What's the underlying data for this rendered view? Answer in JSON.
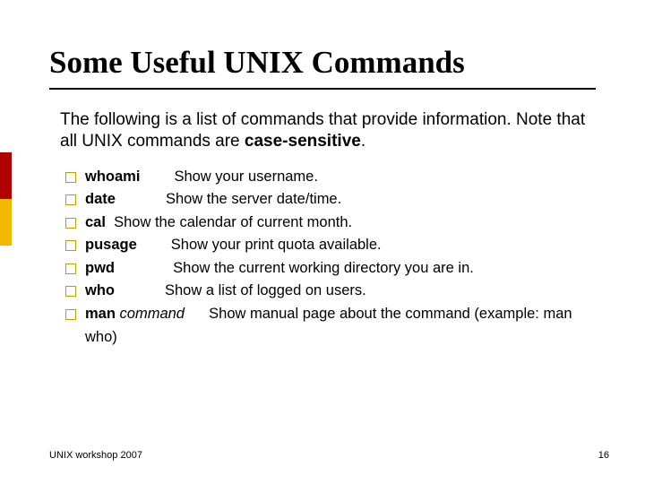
{
  "title": "Some Useful UNIX Commands",
  "intro_part1": "The following is a list of commands that provide information. Note that all UNIX commands are ",
  "intro_cs": "case-sensitive",
  "intro_part2": ".",
  "items": [
    {
      "cmd": "whoami",
      "desc": "Show your username."
    },
    {
      "cmd": "date",
      "desc": "Show the server date/time."
    },
    {
      "cmd": "cal",
      "desc": "Show the calendar of current month."
    },
    {
      "cmd": "pusage",
      "desc": "Show your print quota available."
    },
    {
      "cmd": "pwd",
      "desc": "Show the current working directory you are in."
    },
    {
      "cmd": "who",
      "desc": "Show a list of logged on users."
    }
  ],
  "man": {
    "cmd": "man",
    "arg": "command",
    "desc": "Show manual page about the command (example: man who)"
  },
  "footer_left": "UNIX workshop 2007",
  "footer_right": "16"
}
